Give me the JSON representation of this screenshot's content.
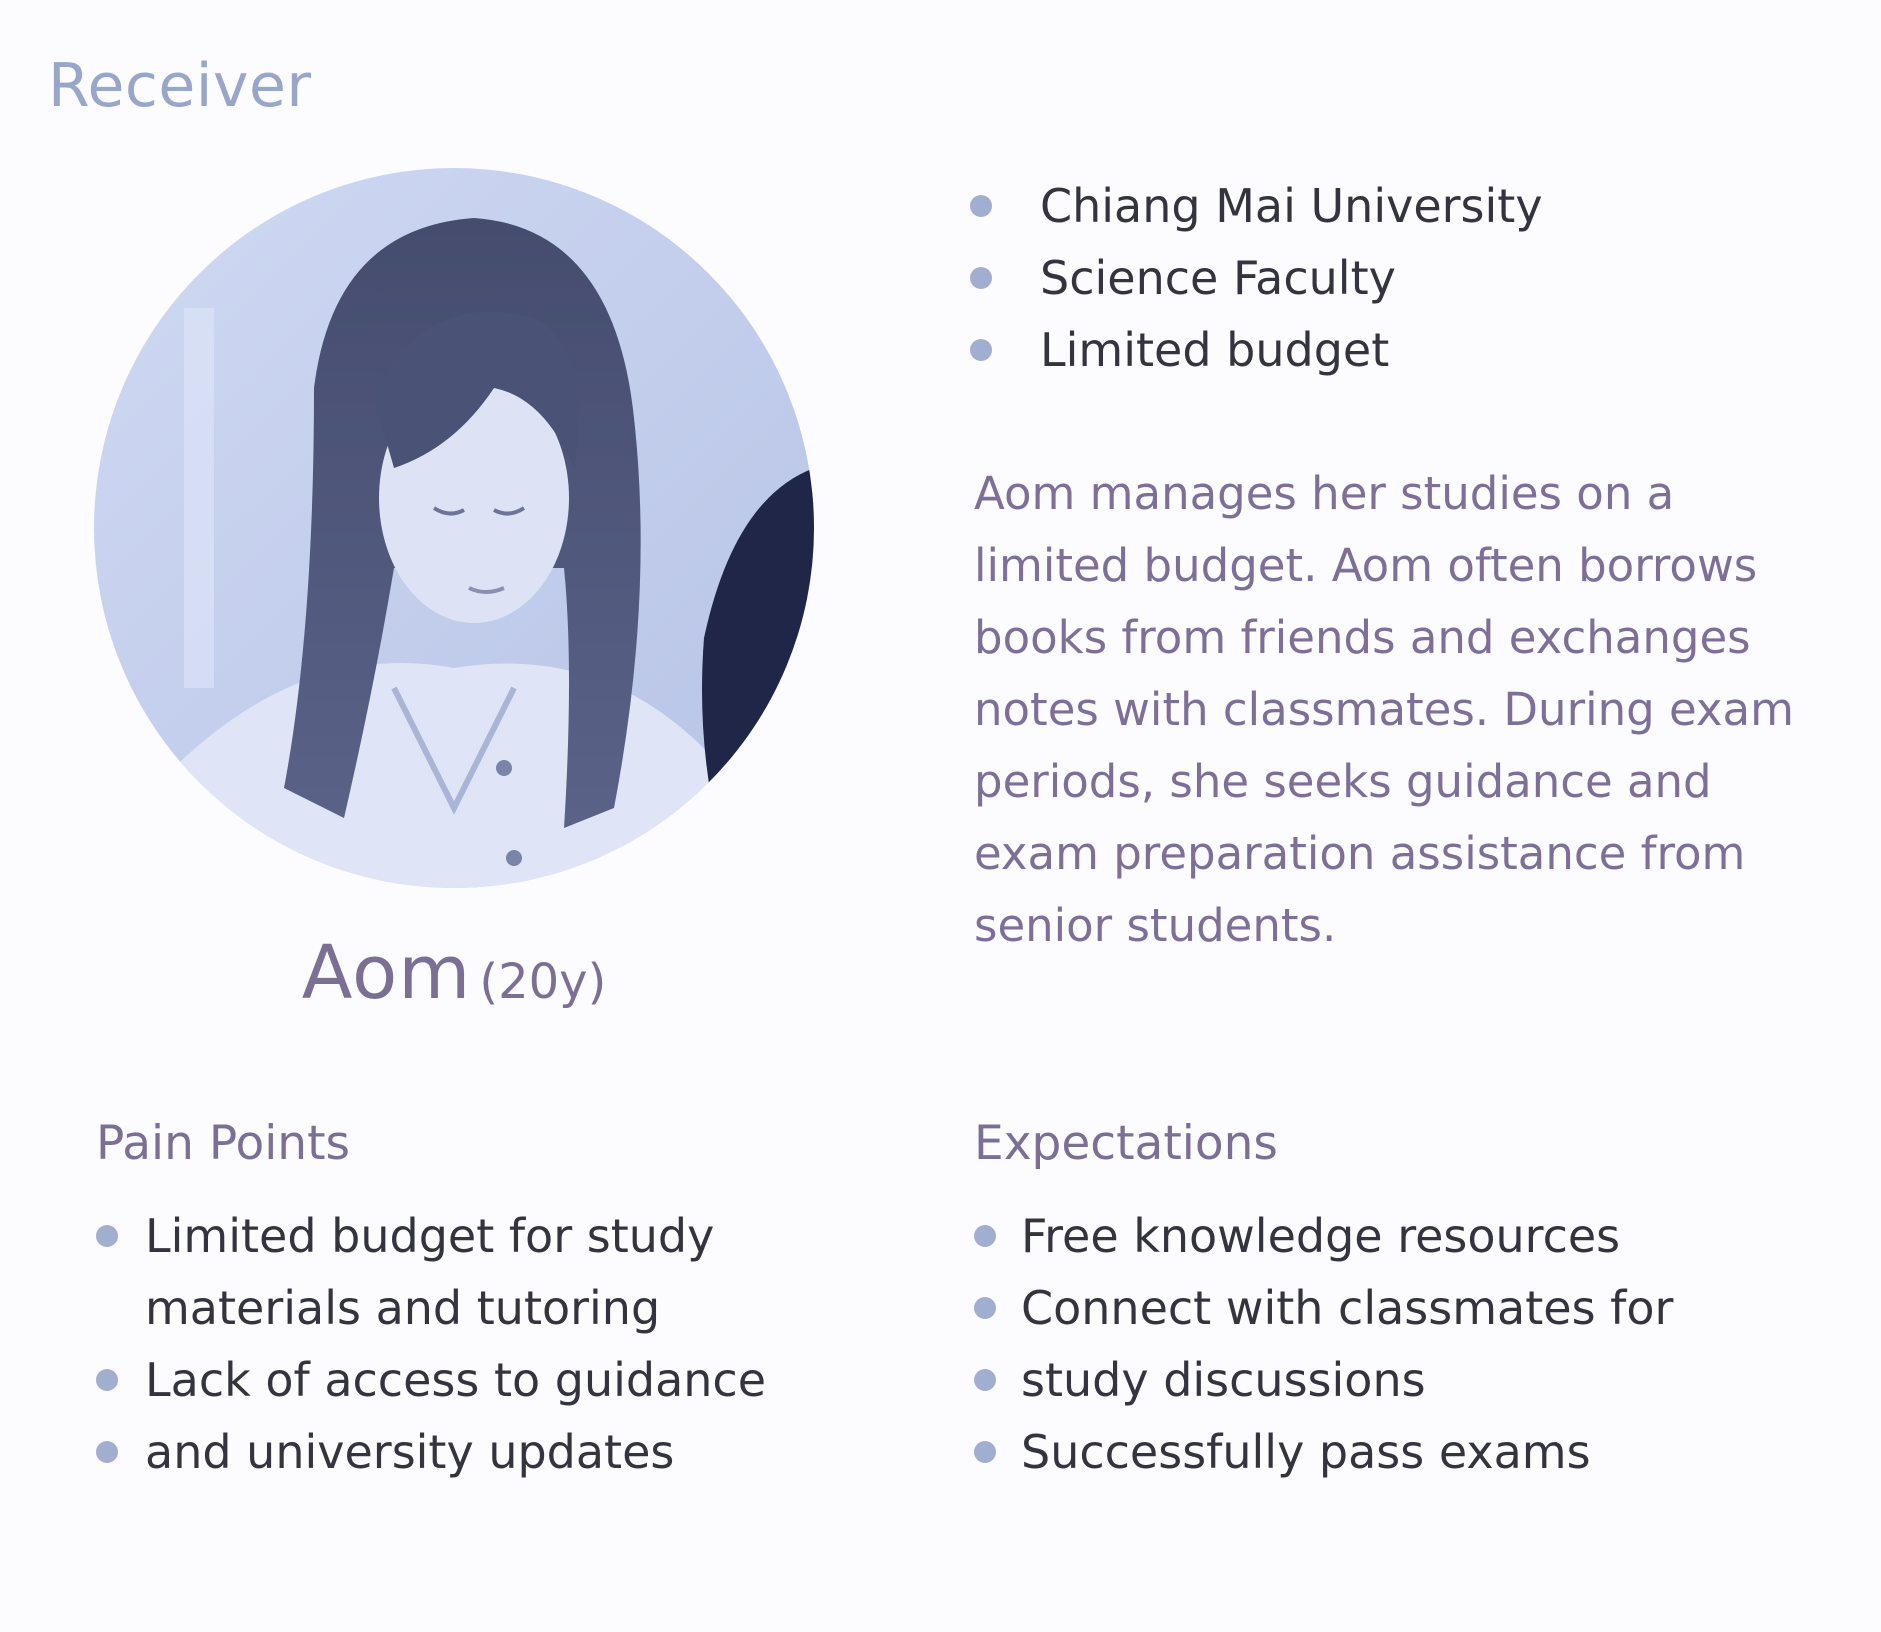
{
  "header": {
    "title": "Receiver"
  },
  "profile": {
    "name": "Aom",
    "age": "(20y)",
    "photo_icon": "person-photo"
  },
  "facts": [
    "Chiang Mai University",
    "Science Faculty",
    "Limited budget"
  ],
  "description": "Aom manages her studies on a limited budget.  Aom often borrows books from friends and exchanges notes with classmates. During exam periods, she seeks guidance and exam preparation assistance from senior students.",
  "pain_points": {
    "title": "Pain Points",
    "items": [
      "Limited budget for study materials and tutoring",
      "Lack of access to guidance",
      "and university updates"
    ]
  },
  "expectations": {
    "title": "Expectations",
    "items": [
      "Free knowledge resources",
      "Connect with classmates for",
      "study discussions",
      "Successfully pass exams"
    ]
  },
  "colors": {
    "accent": "#98a6c9",
    "bullet": "#a2aed0",
    "heading": "#7c6f95",
    "body_text": "#34343f",
    "description_text": "#7d6f98",
    "photo_tint": "#c7d2ef"
  }
}
